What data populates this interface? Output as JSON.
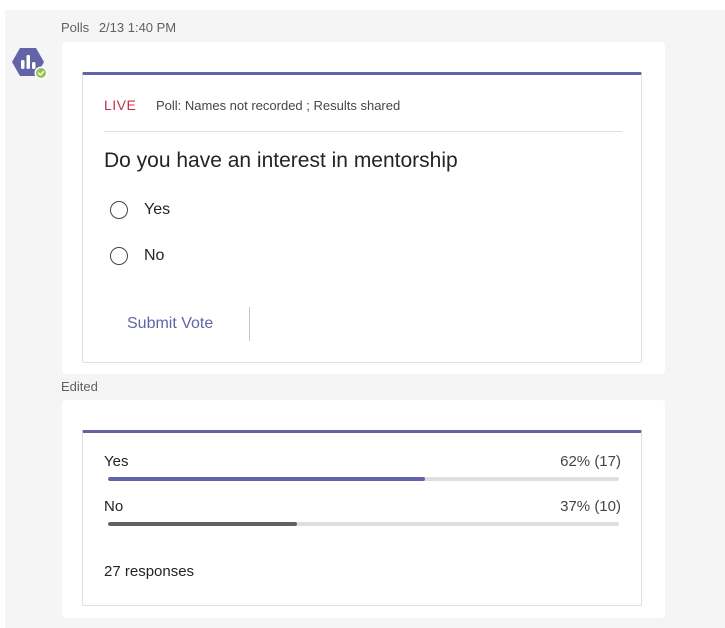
{
  "app": {
    "bot_name": "Polls",
    "timestamp": "2/13 1:40 PM",
    "avatar_icon": "polls-bot-icon",
    "status_icon": "available-status-icon"
  },
  "poll": {
    "status": "LIVE",
    "meta": "Poll: Names not recorded ; Results shared",
    "question": "Do you have an interest in mentorship",
    "options": [
      {
        "label": "Yes"
      },
      {
        "label": "No"
      }
    ],
    "submit_label": "Submit Vote"
  },
  "edited_label": "Edited",
  "results": {
    "rows": [
      {
        "label": "Yes",
        "value_text": "62% (17)",
        "fraction": 0.62,
        "color": "#6264a7"
      },
      {
        "label": "No",
        "value_text": "37% (10)",
        "fraction": 0.37,
        "color": "#616161"
      }
    ],
    "responses_text": "27 responses"
  },
  "colors": {
    "accent": "#6264a7",
    "live": "#c4314b",
    "presence": "#92c353"
  }
}
